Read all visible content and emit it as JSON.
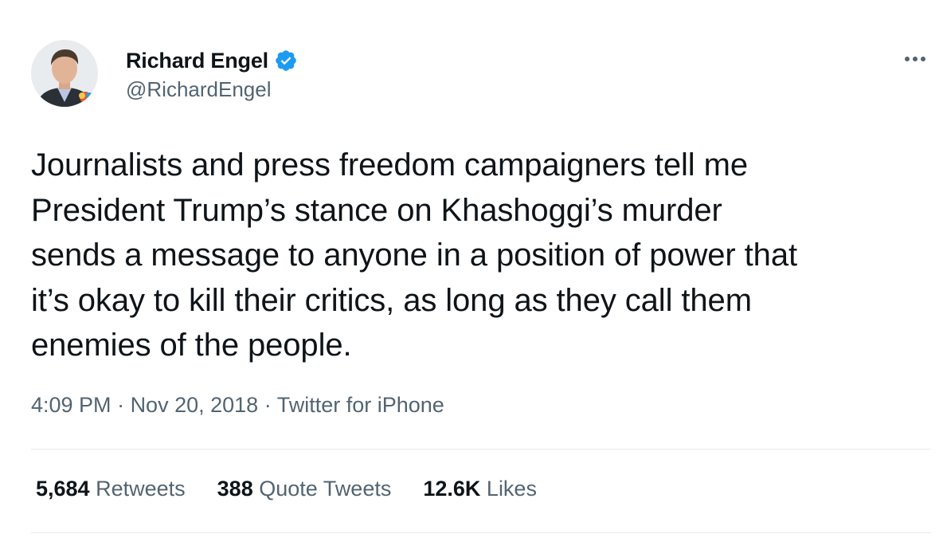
{
  "author": {
    "display_name": "Richard Engel",
    "handle": "@RichardEngel",
    "verified": true,
    "verified_color": "#1d9bf0",
    "avatar_icon": "person-avatar"
  },
  "tweet": {
    "text": "Journalists and press freedom campaigners tell me\nPresident Trump’s stance on Khashoggi’s murder\nsends a message to anyone in a position of power that\nit’s okay to kill their critics, as long as they call them\nenemies of the people.",
    "time": "4:09 PM",
    "date": "Nov 20, 2018",
    "separator": " · ",
    "source": "Twitter for iPhone"
  },
  "stats": {
    "retweets": {
      "count": "5,684",
      "label": "Retweets"
    },
    "quotes": {
      "count": "388",
      "label": "Quote Tweets"
    },
    "likes": {
      "count": "12.6K",
      "label": "Likes"
    }
  },
  "menu": {
    "more_icon": "more-horizontal-icon"
  }
}
